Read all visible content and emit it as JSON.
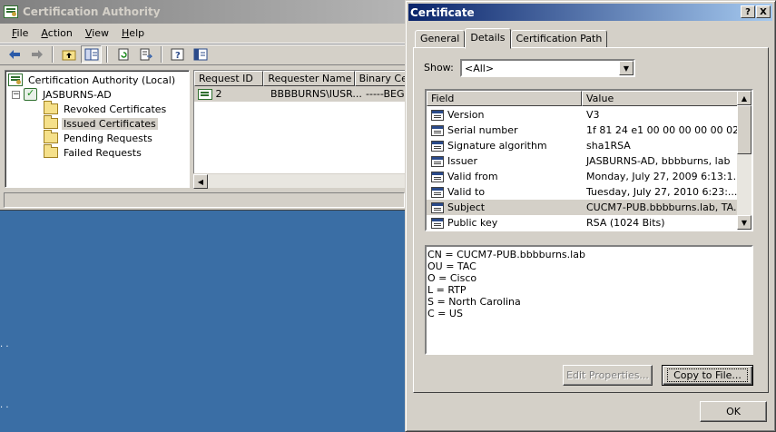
{
  "mmc": {
    "title": "Certification Authority",
    "menu": [
      {
        "underline": "F",
        "rest": "ile"
      },
      {
        "underline": "A",
        "rest": "ction"
      },
      {
        "underline": "V",
        "rest": "iew"
      },
      {
        "underline": "H",
        "rest": "elp"
      }
    ],
    "tree": {
      "root": "Certification Authority (Local)",
      "ca_node": "JASBURNS-AD",
      "expander": "−",
      "folders": [
        "Revoked Certificates",
        "Issued Certificates",
        "Pending Requests",
        "Failed Requests"
      ]
    },
    "list": {
      "columns": [
        "Request ID",
        "Requester Name",
        "Binary Ce"
      ],
      "rows": [
        {
          "request_id": "2",
          "requester": "BBBBURNS\\IUSR...",
          "binary": "-----BEGI"
        }
      ]
    },
    "desktop_dots": [
      ". .",
      ". ."
    ]
  },
  "dialog": {
    "title": "Certificate",
    "help_btn": "?",
    "close_btn": "X",
    "tabs": [
      "General",
      "Details",
      "Certification Path"
    ],
    "active_tab": "Details",
    "show_label": "Show:",
    "show_value": "<All>",
    "fields_header": {
      "field": "Field",
      "value": "Value"
    },
    "fields": [
      {
        "field": "Version",
        "value": "V3"
      },
      {
        "field": "Serial number",
        "value": "1f 81 24 e1 00 00 00 00 00 02"
      },
      {
        "field": "Signature algorithm",
        "value": "sha1RSA"
      },
      {
        "field": "Issuer",
        "value": "JASBURNS-AD, bbbburns, lab"
      },
      {
        "field": "Valid from",
        "value": "Monday, July 27, 2009 6:13:1..."
      },
      {
        "field": "Valid to",
        "value": "Tuesday, July 27, 2010 6:23:..."
      },
      {
        "field": "Subject",
        "value": "CUCM7-PUB.bbbburns.lab, TA..."
      },
      {
        "field": "Public key",
        "value": "RSA (1024 Bits)"
      }
    ],
    "selected_field": "Subject",
    "detail_lines": [
      "CN = CUCM7-PUB.bbbburns.lab",
      "OU = TAC",
      "O = Cisco",
      "L = RTP",
      "S = North Carolina",
      "C = US"
    ],
    "edit_properties_label": "Edit Properties...",
    "copy_to_file_label": "Copy to File...",
    "ok_label": "OK"
  }
}
